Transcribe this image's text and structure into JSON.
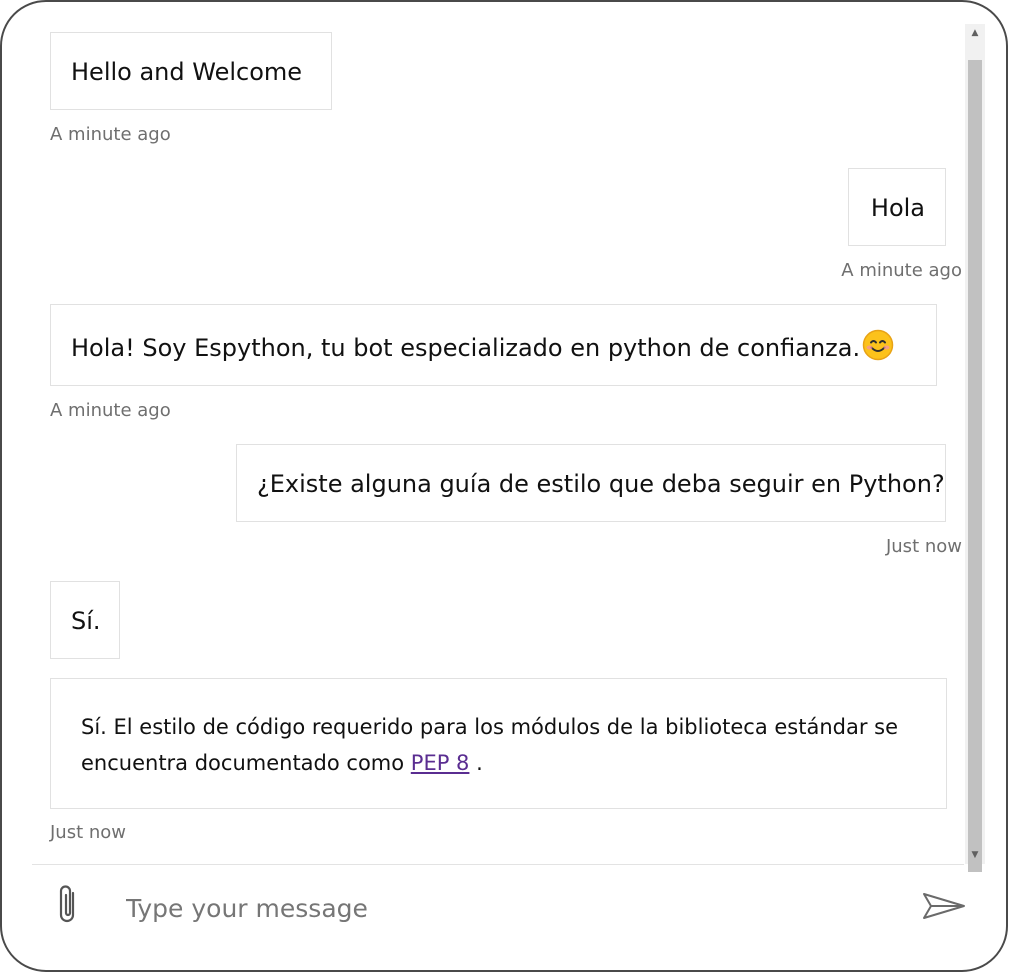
{
  "transcript": {
    "messages": [
      {
        "from": "bot",
        "text": "Hello and Welcome",
        "timestamp": "A minute ago"
      },
      {
        "from": "user",
        "text": "Hola",
        "timestamp": "A minute ago"
      },
      {
        "from": "bot",
        "text": "Hola! Soy Espython, tu bot especializado en python de confianza.",
        "emoji": "smiling-face-emoji",
        "timestamp": "A minute ago"
      },
      {
        "from": "user",
        "text": "¿Existe alguna guía de estilo que deba seguir en Python?",
        "timestamp": "Just now"
      },
      {
        "from": "bot",
        "text": "Sí."
      },
      {
        "from": "bot",
        "text_before_link": "Sí. El estilo de código requerido para los módulos de la biblioteca estándar se encuentra documentado como ",
        "link_text": "PEP 8",
        "text_after_link": " .",
        "timestamp": "Just now"
      }
    ]
  },
  "composer": {
    "placeholder": "Type your message",
    "value": "",
    "attach_icon": "paperclip-icon",
    "send_icon": "send-icon"
  },
  "colors": {
    "link": "#5a2d91",
    "bubble_border": "#e1e1e1",
    "timestamp": "#6f6f6f",
    "frame_border": "#4a4a4a",
    "scroll_thumb": "#c1c1c1"
  }
}
